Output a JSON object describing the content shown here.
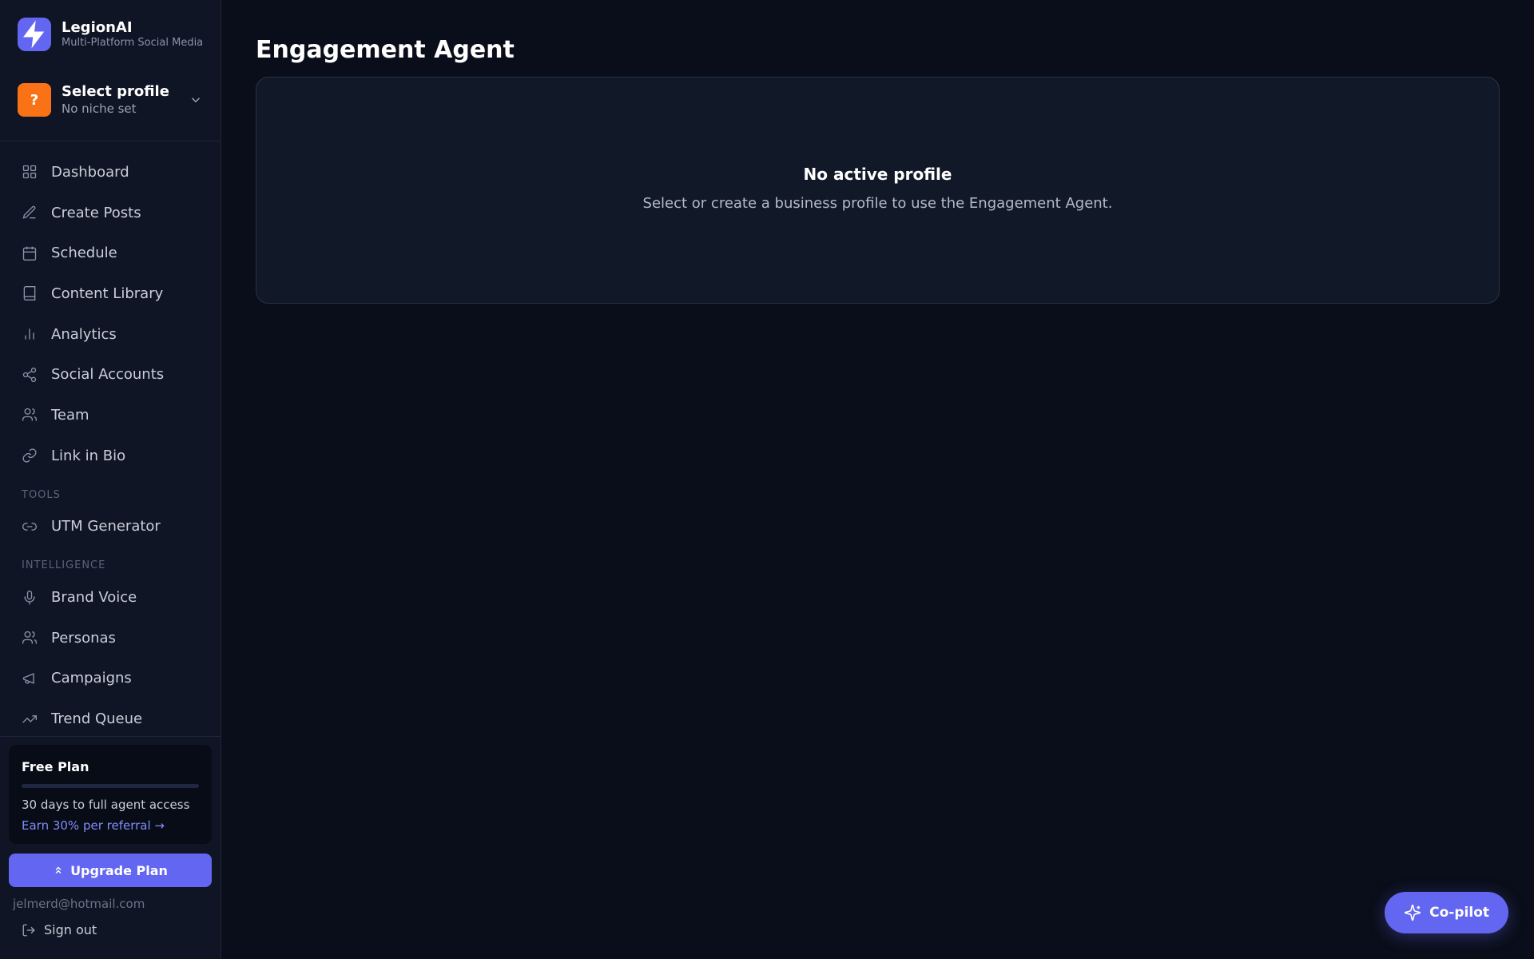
{
  "brand": {
    "name": "LegionAI",
    "subtitle": "Multi-Platform Social Media",
    "logo_icon": "lightning-icon",
    "color": "#6366f1"
  },
  "profile": {
    "avatar": "?",
    "name": "Select profile",
    "niche": "No niche set",
    "avatar_color": "#f97316"
  },
  "nav": {
    "items": [
      {
        "label": "Dashboard",
        "icon": "grid-icon"
      },
      {
        "label": "Create Posts",
        "icon": "pen-icon"
      },
      {
        "label": "Schedule",
        "icon": "calendar-icon"
      },
      {
        "label": "Content Library",
        "icon": "book-icon"
      },
      {
        "label": "Analytics",
        "icon": "bar-chart-icon"
      },
      {
        "label": "Social Accounts",
        "icon": "share-icon"
      },
      {
        "label": "Team",
        "icon": "users-icon"
      },
      {
        "label": "Link in Bio",
        "icon": "link-icon"
      }
    ],
    "tools_label": "TOOLS",
    "tools": [
      {
        "label": "UTM Generator",
        "icon": "link-chain-icon"
      }
    ],
    "intelligence_label": "INTELLIGENCE",
    "intelligence": [
      {
        "label": "Brand Voice",
        "icon": "microphone-icon"
      },
      {
        "label": "Personas",
        "icon": "users-icon"
      },
      {
        "label": "Campaigns",
        "icon": "megaphone-icon"
      },
      {
        "label": "Trend Queue",
        "icon": "trending-up-icon"
      }
    ]
  },
  "plan": {
    "title": "Free Plan",
    "progress": 0,
    "description": "30 days to full agent access",
    "referral_link": "Earn 30% per referral →",
    "upgrade_label": "Upgrade Plan"
  },
  "user": {
    "email": "jelmerd@hotmail.com",
    "signout_label": "Sign out"
  },
  "main": {
    "title": "Engagement Agent",
    "empty_title": "No active profile",
    "empty_text": "Select or create a business profile to use the Engagement Agent."
  },
  "copilot": {
    "label": "Co-pilot",
    "icon": "sparkles-icon"
  },
  "colors": {
    "background": "#0a0e1a",
    "sidebar": "#0f1524",
    "accent": "#6366f1",
    "link": "#818cf8"
  }
}
